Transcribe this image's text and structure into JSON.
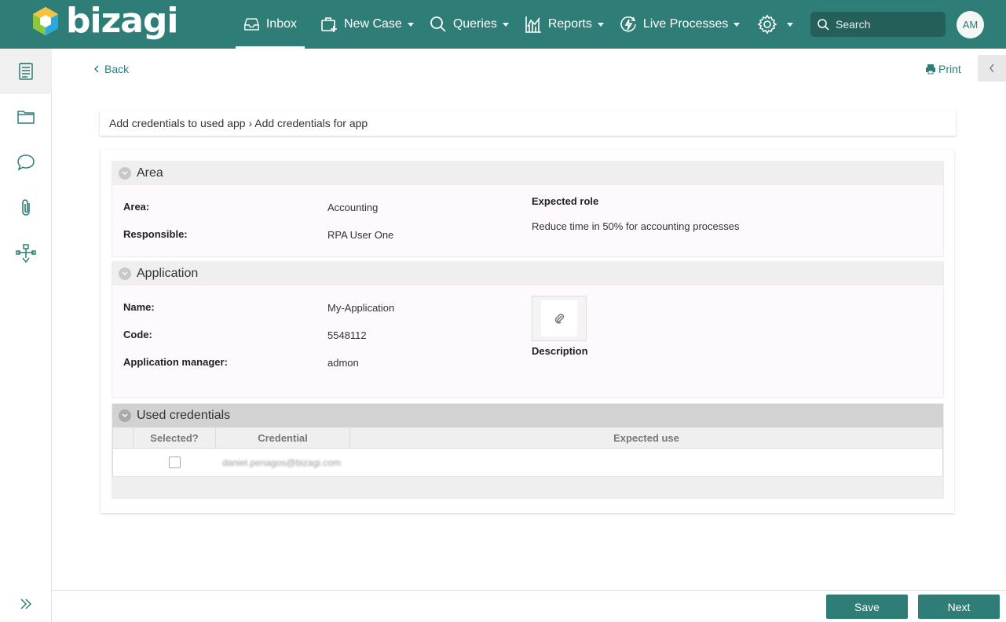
{
  "app": {
    "brand": "bizagi",
    "brand_color": "#2e7d76"
  },
  "nav": {
    "inbox": "Inbox",
    "new_case": "New Case",
    "queries": "Queries",
    "reports": "Reports",
    "live_processes": "Live Processes"
  },
  "search": {
    "placeholder": "Search"
  },
  "user": {
    "initials": "AM"
  },
  "sidebar": {
    "items": [
      "form-icon",
      "folder-icon",
      "comment-icon",
      "attachment-icon",
      "workflow-icon"
    ],
    "expand_icon": "double-chevron-right-icon"
  },
  "page": {
    "back": "Back",
    "print": "Print",
    "breadcrumb": "Add credentials to used app › Add credentials for app"
  },
  "area_group": {
    "title": "Area",
    "area_label": "Area:",
    "area_value": "Accounting",
    "responsible_label": "Responsible:",
    "responsible_value": "RPA User One",
    "expected_role_label": "Expected role",
    "expected_role_value": "Reduce time in 50% for accounting processes"
  },
  "application_group": {
    "title": "Application",
    "name_label": "Name:",
    "name_value": "My-Application",
    "code_label": "Code:",
    "code_value": "5548112",
    "manager_label": "Application manager:",
    "manager_value": "admon",
    "description_label": "Description"
  },
  "credentials_group": {
    "title": "Used credentials",
    "columns": [
      "Selected?",
      "Credential",
      "Expected use"
    ],
    "rows": [
      {
        "selected": false,
        "credential": "daniel.penagos@bizagi.com",
        "expected_use": ""
      }
    ]
  },
  "footer": {
    "save": "Save",
    "next": "Next"
  }
}
